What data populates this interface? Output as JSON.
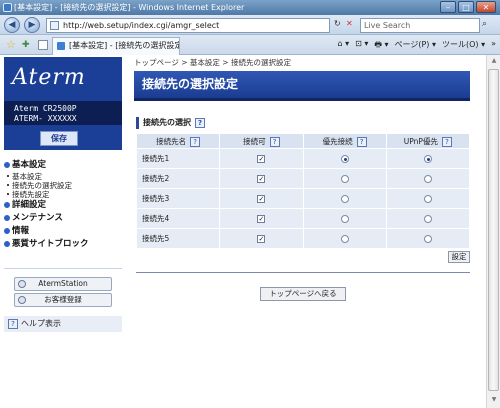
{
  "window": {
    "title": "[基本設定] - [接続先の選択設定] - Windows Internet Explorer",
    "minimize": "–",
    "maximize": "□",
    "close": "✕"
  },
  "address_bar": {
    "back": "◀",
    "forward": "▶",
    "url": "http://web.setup/index.cgi/amgr_select",
    "refresh": "↻",
    "stop": "✕",
    "dropdown": "▾",
    "search_placeholder": "Live Search",
    "search_go": "⌕"
  },
  "tab_bar": {
    "favorites_star": "☆",
    "add_favorite": "✚",
    "tab_title": "[基本設定] - [接続先の選択設定]",
    "toolbar_items": [
      "⌂ ▾",
      "⊡ ▾",
      "🖶 ▾",
      "ページ(P) ▾",
      "ツール(O) ▾",
      "»"
    ]
  },
  "sidebar": {
    "logo": "Aterm",
    "model": "Aterm CR2500P",
    "model_id": "ATERM- XXXXXX",
    "save_button": "保存",
    "menu": [
      {
        "label": "基本設定",
        "subs": [
          "基本設定",
          "接続先の選択設定",
          "接続先設定"
        ]
      },
      {
        "label": "詳細設定",
        "subs": []
      },
      {
        "label": "メンテナンス",
        "subs": []
      },
      {
        "label": "情報",
        "subs": []
      },
      {
        "label": "悪質サイトブロック",
        "subs": []
      }
    ],
    "buttons": [
      "AtermStation",
      "お客様登録"
    ],
    "help": "ヘルプ表示"
  },
  "main": {
    "breadcrumb": "トップページ > 基本設定 > 接続先の選択設定",
    "page_title": "接続先の選択設定",
    "section_title": "接続先の選択",
    "columns": [
      "接続先名",
      "接続可",
      "優先接続",
      "UPnP優先"
    ],
    "rows": [
      {
        "name": "接続先1",
        "enabled": true,
        "priority": true,
        "upnp": true
      },
      {
        "name": "接続先2",
        "enabled": true,
        "priority": false,
        "upnp": false
      },
      {
        "name": "接続先3",
        "enabled": true,
        "priority": false,
        "upnp": false
      },
      {
        "name": "接続先4",
        "enabled": true,
        "priority": false,
        "upnp": false
      },
      {
        "name": "接続先5",
        "enabled": true,
        "priority": false,
        "upnp": false
      }
    ],
    "set_button": "設定",
    "top_button": "トップページへ戻る"
  },
  "icons": {
    "check": "✓",
    "help": "?"
  }
}
